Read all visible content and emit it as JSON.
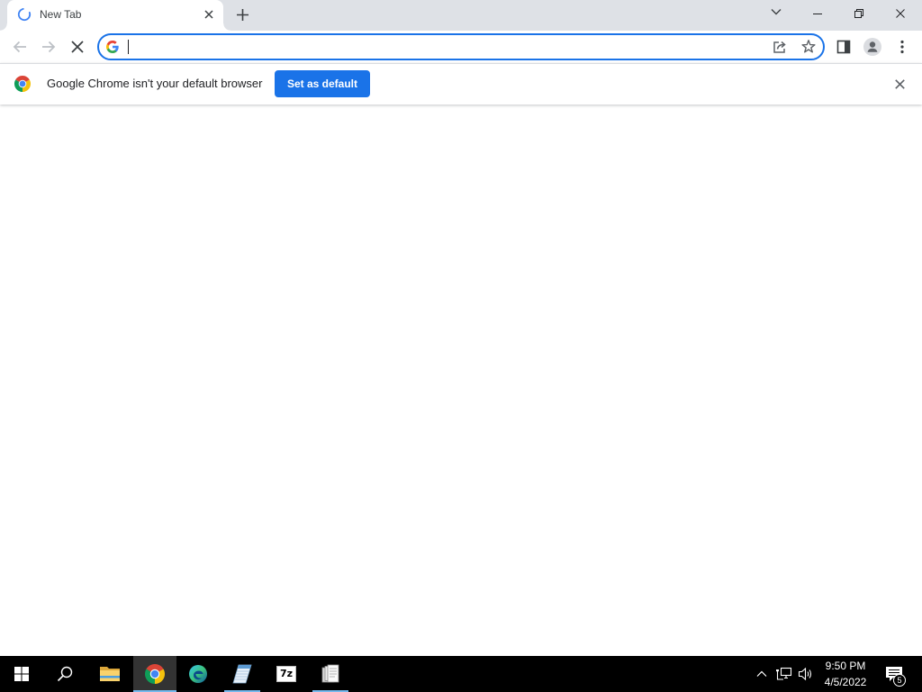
{
  "browser": {
    "tabs": [
      {
        "title": "New Tab",
        "active": true,
        "loading": true,
        "status_icon": "loading-spinner-icon",
        "close_icon": "close-icon"
      }
    ],
    "tabstrip": {
      "new_tab_icon": "plus-icon",
      "tab_search_icon": "chevron-down-icon"
    },
    "window_controls": {
      "minimize_icon": "minimize-icon",
      "restore_icon": "restore-icon",
      "close_icon": "close-icon"
    },
    "toolbar": {
      "back": {
        "icon": "arrow-left-icon",
        "enabled": false
      },
      "forward": {
        "icon": "arrow-right-icon",
        "enabled": false
      },
      "stop": {
        "icon": "stop-loading-icon",
        "enabled": true
      },
      "omnibox": {
        "value": "",
        "focused": true,
        "search_engine_icon": "google-g-icon",
        "actions": [
          {
            "icon": "share-icon"
          },
          {
            "icon": "star-icon"
          }
        ]
      },
      "side_panel_icon": "side-panel-icon",
      "profile_icon": "avatar-icon",
      "menu_icon": "kebab-menu-icon"
    },
    "infobar": {
      "icon": "chrome-logo-icon",
      "message": "Google Chrome isn't your default browser",
      "button_label": "Set as default",
      "close_icon": "close-icon"
    }
  },
  "taskbar": {
    "start_icon": "windows-start-icon",
    "search_icon": "search-icon",
    "apps": [
      {
        "icon": "file-explorer-icon",
        "running": false,
        "active": false
      },
      {
        "icon": "chrome-icon",
        "running": true,
        "active": true
      },
      {
        "icon": "edge-icon",
        "running": false,
        "active": false
      },
      {
        "icon": "notepad-icon",
        "running": true,
        "active": false
      },
      {
        "icon": "7zip-icon",
        "running": false,
        "active": false,
        "logo_text": "7z"
      },
      {
        "icon": "document-app-icon",
        "running": true,
        "active": false
      }
    ],
    "tray": {
      "icons": [
        "chevron-up-icon",
        "network-icon",
        "volume-icon"
      ],
      "time": "9:50 PM",
      "date": "4/5/2022",
      "notification_icon": "notification-icon",
      "notification_count": 5
    }
  },
  "colors": {
    "tabstrip_bg": "#dee1e6",
    "accent": "#1a73e8",
    "taskbar_bg": "#000000",
    "running_indicator": "#76b9ed"
  }
}
